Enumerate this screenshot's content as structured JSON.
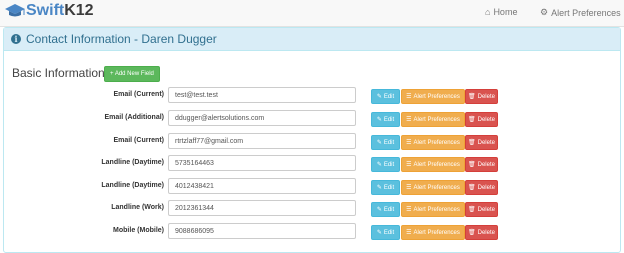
{
  "brand": {
    "part1": "Swift",
    "part2": "K12"
  },
  "nav": {
    "home": {
      "label": "Home",
      "icon": "home-icon"
    },
    "alert_prefs": {
      "label": "Alert Preferences",
      "icon": "gear-icon"
    }
  },
  "panel": {
    "title": "Contact Information - Daren Dugger",
    "icon": "info-circle-icon"
  },
  "section": {
    "title": "Basic Information",
    "add_button": "+ Add New Field"
  },
  "row_actions": {
    "edit": "Edit",
    "alert": "Alert Preferences",
    "delete": "Delete"
  },
  "contacts": [
    {
      "label": "Email (Current)",
      "value": "test@test.test"
    },
    {
      "label": "Email (Additional)",
      "value": "ddugger@alertsolutions.com"
    },
    {
      "label": "Email (Current)",
      "value": "rtrtzlaff77@gmail.com"
    },
    {
      "label": "Landline (Daytime)",
      "value": "5735164463"
    },
    {
      "label": "Landline (Daytime)",
      "value": "4012438421"
    },
    {
      "label": "Landline (Work)",
      "value": "2012361344"
    },
    {
      "label": "Mobile (Mobile)",
      "value": "9088686095"
    }
  ],
  "colors": {
    "edit": "#5bc0de",
    "alert": "#f0ad4e",
    "delete": "#d9534f",
    "add": "#5cb85c",
    "panel_heading": "#d9edf7"
  }
}
